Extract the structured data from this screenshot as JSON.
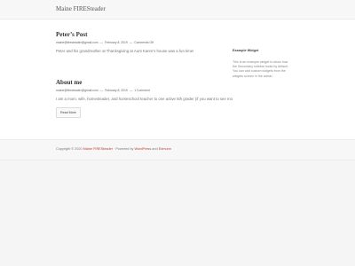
{
  "header": {
    "site_title": "Maine FIRESteader"
  },
  "posts": [
    {
      "title": "Peter’s Post",
      "author": "maine@firesteader@gmail.com",
      "date": "February 8, 2019",
      "comments": "Comments Off",
      "excerpt": "Peter and his grandmother at Thanksgiving at Aunt Karen’s house was a fun time!"
    },
    {
      "title": "About me",
      "author": "maine@firesteader@gmail.com",
      "date": "February 8, 2019",
      "comments": "1 Comment",
      "excerpt": "I am a mom, wife, homesteader, and homeschool teacher to one active 5th grader (if you want to see mo",
      "read_more": "Read More"
    }
  ],
  "sidebar": {
    "widget_title": "Example Widget",
    "widget_text": "This is an example widget to show how the Secondary sidebar looks by default. You can add custom widgets from the widgets screen in the admin."
  },
  "footer": {
    "prefix": "Copyright © 2020",
    "site_link": "Maine FIRESteader",
    "powered": "· Powered by",
    "wp_link": "WordPress",
    "and": "and",
    "theme_link": "Edmunn"
  }
}
